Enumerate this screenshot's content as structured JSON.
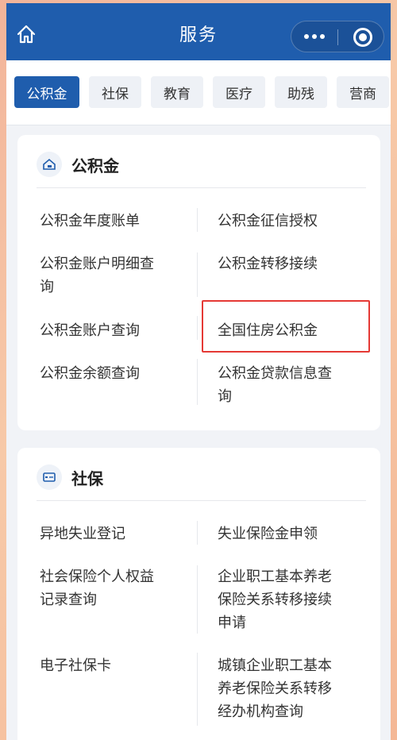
{
  "header": {
    "title": "服务",
    "home_icon": "home-icon",
    "more_icon": "more-dots-icon",
    "close_icon": "target-close-icon"
  },
  "tabs": [
    "公积金",
    "社保",
    "教育",
    "医疗",
    "助残",
    "营商"
  ],
  "active_tab": "公积金",
  "sections": [
    {
      "title": "公积金",
      "icon": "house-fund-icon",
      "items": [
        [
          "公积金年度账单",
          "公积金征信授权"
        ],
        [
          "公积金账户明细查",
          "公积金转移接续"
        ],
        [
          "询",
          ""
        ],
        [
          "公积金账户查询",
          "全国住房公积金"
        ],
        [
          "公积金余额查询",
          "公积金贷款信息查"
        ],
        [
          "",
          "询"
        ]
      ]
    },
    {
      "title": "社保",
      "icon": "social-card-icon",
      "items": [
        [
          "异地失业登记",
          "失业保险金申领"
        ],
        [
          "社会保险个人权益",
          "企业职工基本养老"
        ],
        [
          "记录查询",
          "保险关系转移接续"
        ],
        [
          "",
          "申请"
        ],
        [
          "电子社保卡",
          "城镇企业职工基本"
        ],
        [
          "",
          "养老保险关系转移"
        ],
        [
          "",
          "经办机构查询"
        ]
      ]
    }
  ],
  "colors": {
    "primary": "#1f5dad",
    "highlight": "#e53935"
  }
}
